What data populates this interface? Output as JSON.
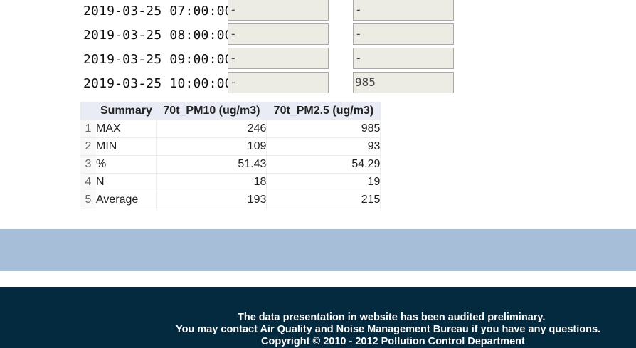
{
  "rows": [
    {
      "time": "2019-03-25 07:00:00",
      "pm10": "-",
      "pm25": "-"
    },
    {
      "time": "2019-03-25 08:00:00",
      "pm10": "-",
      "pm25": "-"
    },
    {
      "time": "2019-03-25 09:00:00",
      "pm10": "-",
      "pm25": "-"
    },
    {
      "time": "2019-03-25 10:00:00",
      "pm10": "-",
      "pm25": "985"
    }
  ],
  "summary": {
    "headers": [
      "Summary",
      "70t_PM10 (ug/m3)",
      "70t_PM2.5 (ug/m3)"
    ],
    "rows": [
      {
        "index": "1",
        "label": "MAX",
        "pm10": "246",
        "pm25": "985"
      },
      {
        "index": "2",
        "label": "MIN",
        "pm10": "109",
        "pm25": "93"
      },
      {
        "index": "3",
        "label": "%",
        "pm10": "51.43",
        "pm25": "54.29"
      },
      {
        "index": "4",
        "label": "N",
        "pm10": "18",
        "pm25": "19"
      },
      {
        "index": "5",
        "label": "Average",
        "pm10": "193",
        "pm25": "215"
      }
    ]
  },
  "footer": {
    "line1": "The data presentation in website has been audited preliminary.",
    "line2": "You may contact Air Quality and Noise Management Bureau if you have any questions.",
    "line3": "Copyright © 2010 - 2012 Pollution Control Department"
  }
}
